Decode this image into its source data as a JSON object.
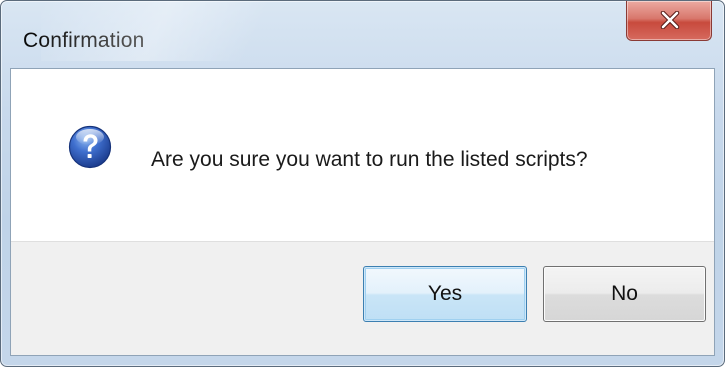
{
  "window": {
    "title": "Confirmation",
    "close_icon": "close-icon"
  },
  "dialog": {
    "icon": "question-icon",
    "message": "Are you sure you want to run the listed scripts?"
  },
  "buttons": {
    "yes_label": "Yes",
    "no_label": "No",
    "default": "yes"
  },
  "colors": {
    "close_button": "#c84a3d",
    "icon_blue": "#2c58b8",
    "default_button_border": "#3c7fb1"
  }
}
